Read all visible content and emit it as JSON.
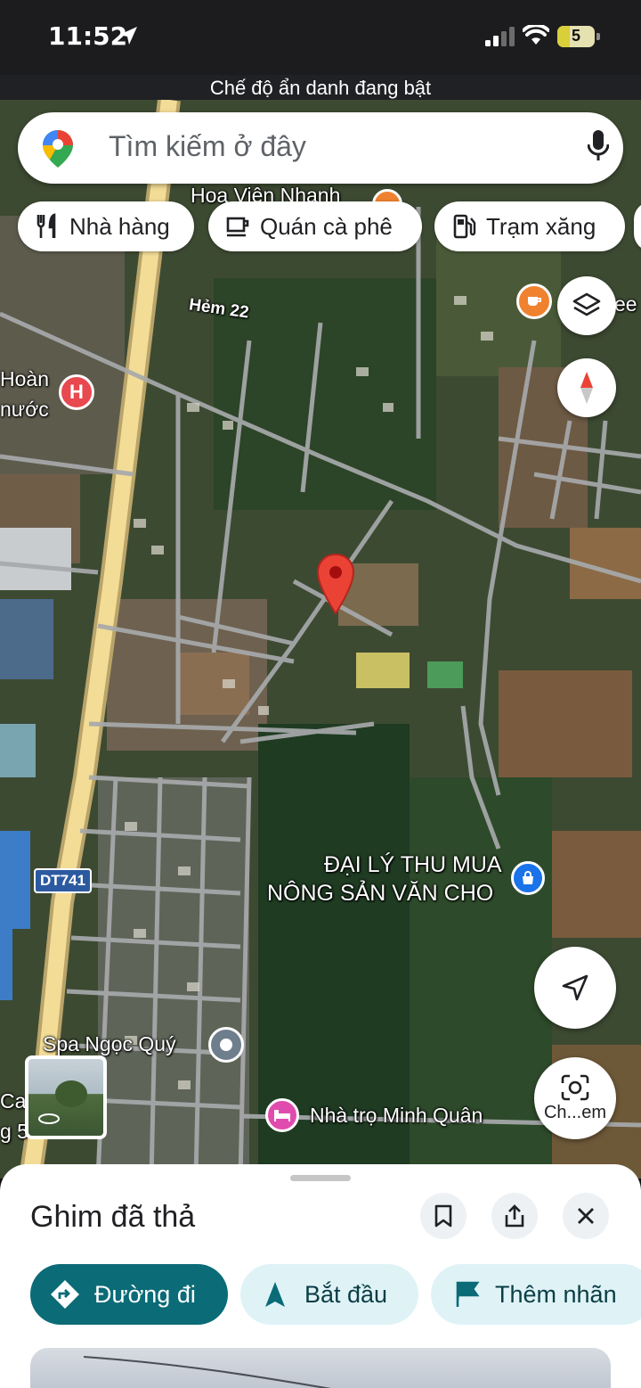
{
  "status_bar": {
    "time": "11:52",
    "battery": "5"
  },
  "incognito_banner": "Chế độ ẩn danh đang bật",
  "search": {
    "placeholder": "Tìm kiếm ở đây"
  },
  "chips": [
    {
      "label": "Nhà hàng",
      "icon": "fork-knife-icon"
    },
    {
      "label": "Quán cà phê",
      "icon": "coffee-cup-icon"
    },
    {
      "label": "Trạm xăng",
      "icon": "gas-pump-icon"
    }
  ],
  "map": {
    "labels": {
      "hoa_vien": "Hoa Viên Nhanh",
      "hem22": "Hẻm 22",
      "hoan": "Hoàn",
      "nuoc": "nước",
      "daily1": "ĐẠI LÝ THU MUA",
      "daily2": "NÔNG SẢN VĂN CHO",
      "road_badge": "DT741",
      "spa": "Spa Ngọc Quý",
      "nhatro": "Nhà trọ Minh Quân",
      "cao": "Cao",
      "g": "g 5",
      "camera_label": "Ch...em",
      "ee": "ee"
    }
  },
  "sheet": {
    "title": "Ghim đã thả",
    "actions": [
      {
        "label": "Đường đi",
        "icon": "directions-icon"
      },
      {
        "label": "Bắt đầu",
        "icon": "navigation-arrow-icon"
      },
      {
        "label": "Thêm nhãn",
        "icon": "flag-icon"
      }
    ]
  },
  "colors": {
    "primary_teal": "#0b6b77",
    "chip_blue_bg": "#dff3f7",
    "pin_red": "#ea4335"
  }
}
